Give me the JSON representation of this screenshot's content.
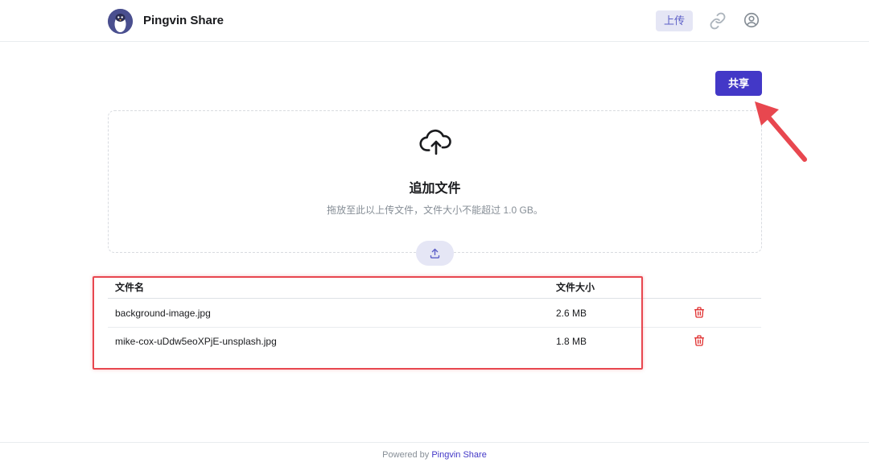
{
  "header": {
    "app_title": "Pingvin Share",
    "nav": {
      "upload_label": "上传",
      "link_icon": "link-icon",
      "user_icon": "user-circle-icon"
    },
    "logo_icon": "penguin-logo-icon"
  },
  "toolbar": {
    "share_label": "共享"
  },
  "dropzone": {
    "icon": "cloud-upload-icon",
    "title": "追加文件",
    "hint": "拖放至此以上传文件，文件大小不能超过 1.0 GB。",
    "upload_button_icon": "upload-icon"
  },
  "file_table": {
    "columns": [
      "文件名",
      "文件大小"
    ],
    "rows": [
      {
        "name": "background-image.jpg",
        "size": "2.6 MB",
        "action_icon": "trash-icon"
      },
      {
        "name": "mike-cox-uDdw5eoXPjE-unsplash.jpg",
        "size": "1.8 MB",
        "action_icon": "trash-icon"
      }
    ]
  },
  "footer": {
    "prefix": "Powered by",
    "brand": "Pingvin Share"
  },
  "colors": {
    "accent": "#4338c7",
    "nav_active_bg": "#e5e6f5",
    "delete_red": "#e03131",
    "annotation_red": "#e8474f"
  }
}
